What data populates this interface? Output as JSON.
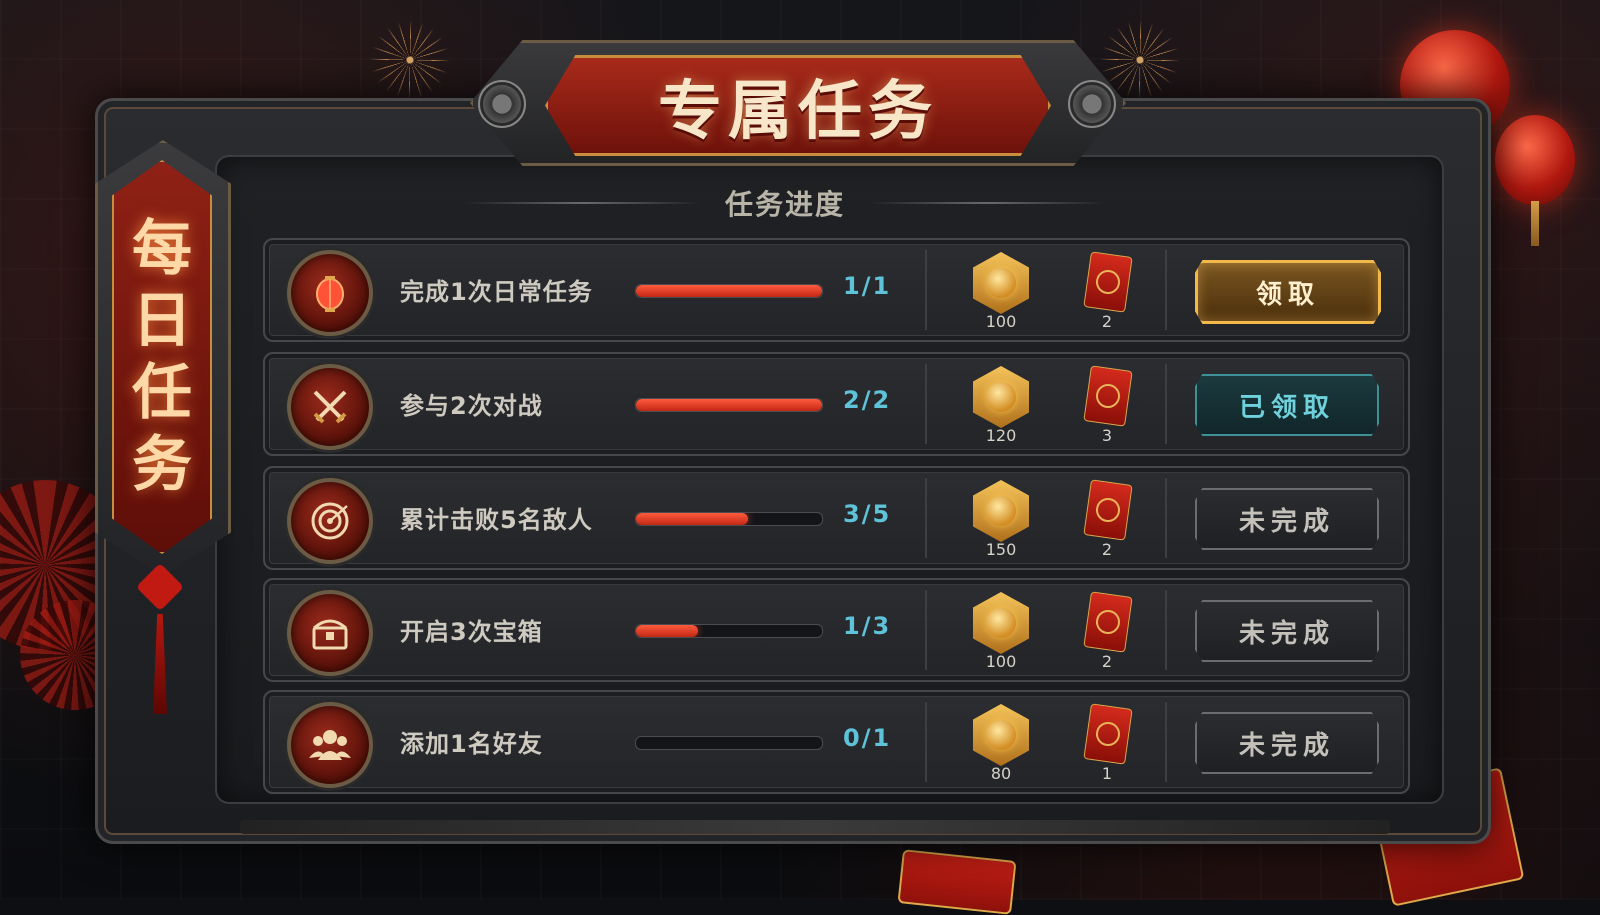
{
  "title": "专属任务",
  "side_banner": [
    "每",
    "日",
    "任",
    "务"
  ],
  "subtitle": "任务进度",
  "colors": {
    "accent_red": "#c22714",
    "progress_text": "#5ec3d8",
    "gold": "#f3b84a",
    "claimed": "#3e8f96"
  },
  "tasks": [
    {
      "name": "完成1次日常任务",
      "icon": "lantern-icon",
      "progress_text": "1/1",
      "progress_fraction": 1.0,
      "coins": "100",
      "packets": "2",
      "button": "领取",
      "state": "claim"
    },
    {
      "name": "参与2次对战",
      "icon": "crossed-swords-icon",
      "progress_text": "2/2",
      "progress_fraction": 1.0,
      "coins": "120",
      "packets": "3",
      "button": "已领取",
      "state": "claimed"
    },
    {
      "name": "累计击败5名敌人",
      "icon": "target-icon",
      "progress_text": "3/5",
      "progress_fraction": 0.6,
      "coins": "150",
      "packets": "2",
      "button": "未完成",
      "state": "pending"
    },
    {
      "name": "开启3次宝箱",
      "icon": "treasure-chest-icon",
      "progress_text": "1/3",
      "progress_fraction": 0.3333,
      "coins": "100",
      "packets": "2",
      "button": "未完成",
      "state": "pending"
    },
    {
      "name": "添加1名好友",
      "icon": "friends-icon",
      "progress_text": "0/1",
      "progress_fraction": 0.0,
      "coins": "80",
      "packets": "1",
      "button": "未完成",
      "state": "pending"
    }
  ]
}
